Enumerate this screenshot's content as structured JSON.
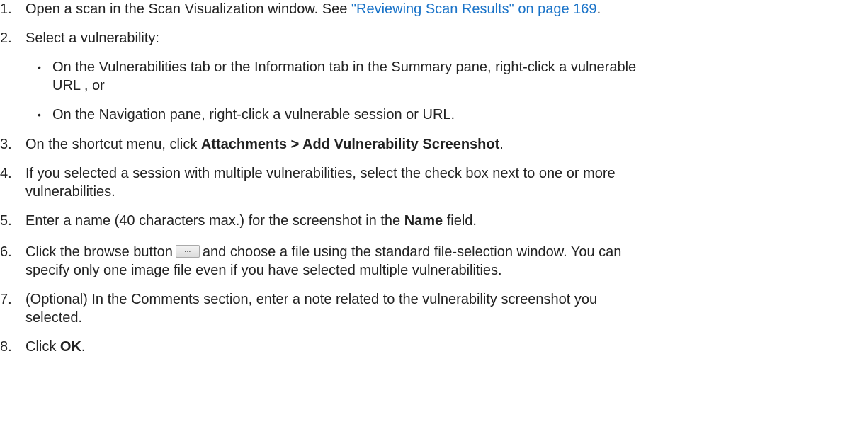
{
  "steps": [
    {
      "number": "1.",
      "text_before": "Open a scan in the Scan Visualization window. See ",
      "link": "\"Reviewing Scan Results\" on page 169",
      "text_after": "."
    },
    {
      "number": "2.",
      "text": "Select a vulnerability:",
      "bullets": [
        {
          "dot": "•",
          "line1": "On the Vulnerabilities tab or the Information tab in the Summary pane, right-click a vulnerable",
          "line2": "URL , or"
        },
        {
          "dot": "•",
          "line1": "On the Navigation pane, right-click a vulnerable session or URL."
        }
      ]
    },
    {
      "number": "3.",
      "text_before": "On the shortcut menu, click ",
      "bold": "Attachments > Add Vulnerability Screenshot",
      "text_after": "."
    },
    {
      "number": "4.",
      "line1": "If you selected a session with multiple vulnerabilities, select the check box next to one or more",
      "line2": "vulnerabilities."
    },
    {
      "number": "5.",
      "text_before": "Enter a name (40 characters max.) for the screenshot in the ",
      "bold": "Name",
      "text_after": " field."
    },
    {
      "number": "6.",
      "text_before": "Click the browse button",
      "button_label": "...",
      "text_after": "and choose a file using the standard file-selection window. You can",
      "line2": "specify only one image file even if you have selected multiple vulnerabilities."
    },
    {
      "number": "7.",
      "line1": "(Optional) In the Comments section, enter a note related to the vulnerability screenshot you",
      "line2": "selected."
    },
    {
      "number": "8.",
      "text_before": "Click ",
      "bold": "OK",
      "text_after": "."
    }
  ]
}
